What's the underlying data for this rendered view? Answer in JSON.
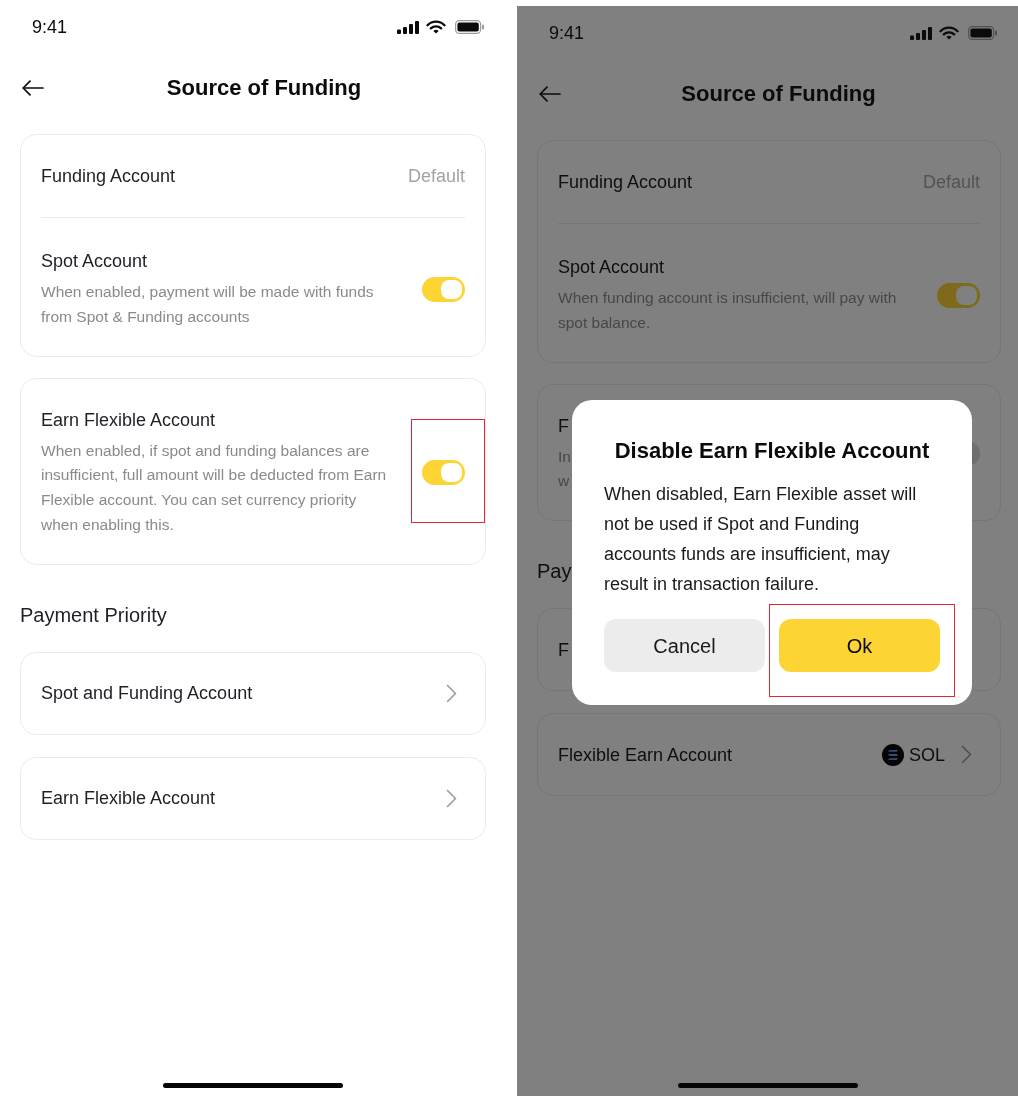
{
  "screens": [
    {
      "dimmed": false,
      "status_bar": {
        "time": "9:41"
      },
      "header": {
        "title": "Source of Funding"
      },
      "cards": [
        {
          "rows": [
            {
              "kind": "value",
              "label": "Funding Account",
              "value": "Default"
            },
            {
              "kind": "toggle",
              "label": "Spot Account",
              "description_lines": [
                "When enabled, payment will be made with funds",
                "from Spot & Funding accounts"
              ],
              "on": true,
              "highlighted": false
            }
          ]
        },
        {
          "rows": [
            {
              "kind": "toggle",
              "label": "Earn Flexible Account",
              "description_lines": [
                "When enabled, if spot and funding balances are",
                "insufficient, full amount will be deducted from Earn",
                "Flexible account. You can set currency priority",
                "when enabling this."
              ],
              "on": true,
              "highlighted": true
            }
          ]
        }
      ],
      "section_title": "Payment Priority",
      "priority_items": [
        {
          "label": "Spot and Funding Account"
        },
        {
          "label": "Earn Flexible Account"
        }
      ]
    },
    {
      "dimmed": true,
      "status_bar": {
        "time": "9:41"
      },
      "header": {
        "title": "Source of Funding"
      },
      "cards": [
        {
          "rows": [
            {
              "kind": "value",
              "label": "Funding Account",
              "value": "Default"
            },
            {
              "kind": "toggle",
              "label": "Spot Account",
              "description_lines": [
                "When funding account is insufficient, will pay with",
                "spot balance."
              ],
              "on": true,
              "highlighted": false
            }
          ]
        },
        {
          "rows": [
            {
              "kind": "toggle",
              "label": "F",
              "description_lines": [
                "In",
                "w"
              ],
              "on": false,
              "highlighted": false
            }
          ]
        }
      ],
      "section_title": "Pay",
      "priority_items": [
        {
          "label": "F"
        },
        {
          "label": "Flexible Earn Account",
          "asset": "SOL"
        }
      ],
      "dialog": {
        "title": "Disable Earn Flexible Account",
        "message_lines": [
          "When disabled, Earn Flexible asset will",
          "not be used if Spot and Funding",
          "accounts funds are insufficient, may",
          "result in transaction failure."
        ],
        "buttons": [
          {
            "kind": "secondary",
            "label": "Cancel",
            "highlighted": false
          },
          {
            "kind": "primary",
            "label": "Ok",
            "highlighted": true
          }
        ]
      }
    }
  ]
}
